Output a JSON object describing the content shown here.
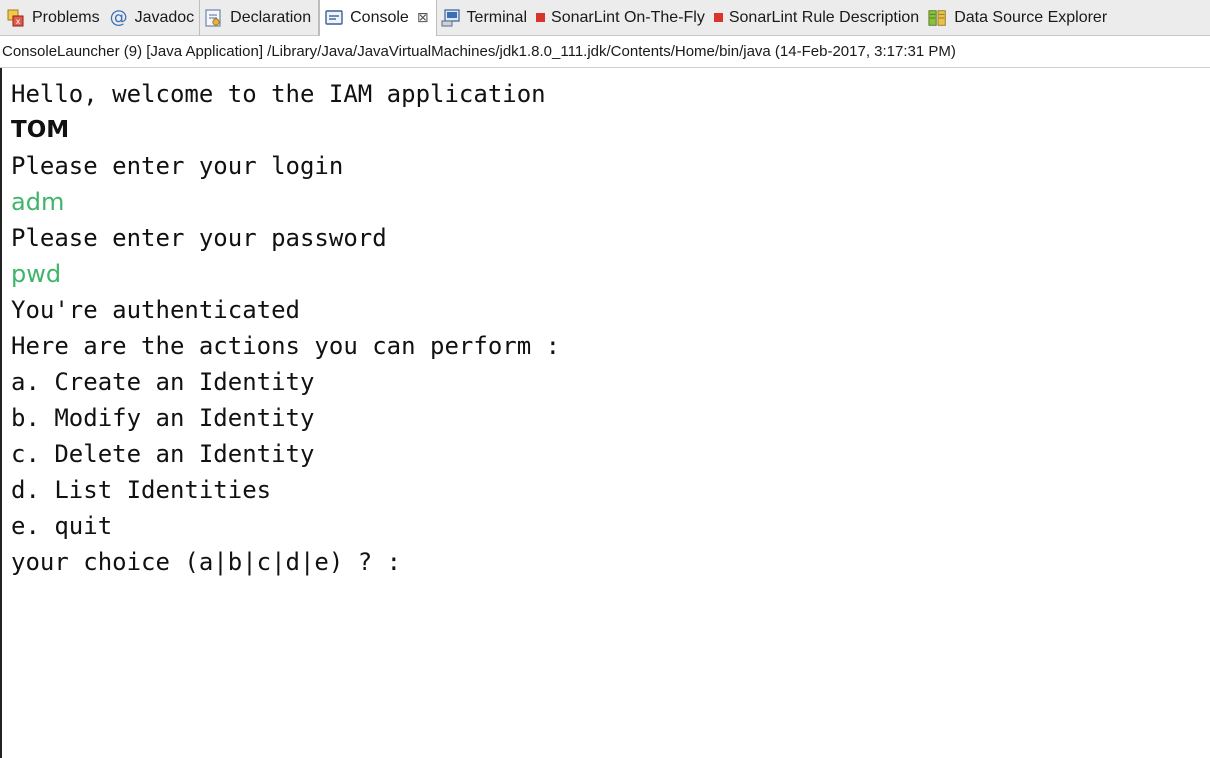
{
  "tabs": [
    {
      "id": "problems",
      "label": "Problems",
      "icon": "problems-icon"
    },
    {
      "id": "javadoc",
      "label": "Javadoc",
      "icon": "at-icon"
    },
    {
      "id": "declaration",
      "label": "Declaration",
      "icon": "declaration-icon"
    },
    {
      "id": "console",
      "label": "Console",
      "icon": "console-icon",
      "active": true,
      "close": "⊠"
    },
    {
      "id": "terminal",
      "label": "Terminal",
      "icon": "terminal-icon"
    },
    {
      "id": "sonarlint-onthefly",
      "label": "SonarLint On-The-Fly",
      "icon": "sonarlint-icon"
    },
    {
      "id": "sonarlint-rule",
      "label": "SonarLint Rule Description",
      "icon": "sonarlint-icon"
    },
    {
      "id": "datasource",
      "label": "Data Source Explorer",
      "icon": "datasource-icon"
    }
  ],
  "console_description": "ConsoleLauncher (9) [Java Application] /Library/Java/JavaVirtualMachines/jdk1.8.0_111.jdk/Contents/Home/bin/java (14-Feb-2017, 3:17:31 PM)",
  "console_lines": [
    {
      "text": "Hello, welcome to the IAM application",
      "kind": "output"
    },
    {
      "text": "TOM",
      "kind": "output-bold"
    },
    {
      "text": "Please enter your login",
      "kind": "output"
    },
    {
      "text": "adm",
      "kind": "input"
    },
    {
      "text": "Please enter your password",
      "kind": "output"
    },
    {
      "text": "pwd",
      "kind": "input"
    },
    {
      "text": "You're authenticated",
      "kind": "output"
    },
    {
      "text": "Here are the actions you can perform :",
      "kind": "output"
    },
    {
      "text": "a. Create an Identity",
      "kind": "output"
    },
    {
      "text": "b. Modify an Identity",
      "kind": "output"
    },
    {
      "text": "c. Delete an Identity",
      "kind": "output"
    },
    {
      "text": "d. List Identities",
      "kind": "output"
    },
    {
      "text": "e. quit",
      "kind": "output"
    },
    {
      "text": "your choice (a|b|c|d|e) ? :",
      "kind": "output"
    }
  ],
  "colors": {
    "input_text": "#3fb56a",
    "sonarlint_marker": "#d9342b",
    "tabbar_bg": "#ececec"
  }
}
